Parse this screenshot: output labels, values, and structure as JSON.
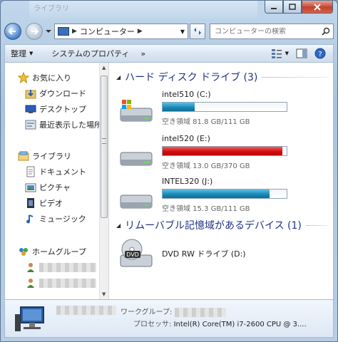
{
  "window": {
    "behind_text": "ライブラリ"
  },
  "address": {
    "breadcrumb": "コンピューター",
    "search_placeholder": "コンピューターの検索"
  },
  "toolbar": {
    "organize": "整理",
    "system_properties": "システムのプロパティ",
    "more": "»"
  },
  "nav": {
    "favorites": "お気に入り",
    "downloads": "ダウンロード",
    "desktop": "デスクトップ",
    "recent": "最近表示した場所",
    "libraries": "ライブラリ",
    "documents": "ドキュメント",
    "pictures": "ピクチャ",
    "videos": "ビデオ",
    "music": "ミュージック",
    "homegroup": "ホームグループ"
  },
  "groups": {
    "hdd": "ハード ディスク ドライブ (3)",
    "removable": "リムーバブル記憶域があるデバイス (1)"
  },
  "drives": [
    {
      "name": "intel510 (C:)",
      "free": "空き領域 81.8 GB/111 GB",
      "used_fraction": 0.26,
      "color": "#1b8ab6"
    },
    {
      "name": "intel520 (E:)",
      "free": "空き領域 13.0 GB/370 GB",
      "used_fraction": 0.965,
      "color": "#d40f0f"
    },
    {
      "name": "INTEL320 (J:)",
      "free": "空き領域 15.3 GB/111 GB",
      "used_fraction": 0.86,
      "color": "#1b8ab6"
    }
  ],
  "dvd": {
    "name": "DVD RW ドライブ (D:)"
  },
  "details": {
    "workgroup_label": "ワークグループ:",
    "processor_label": "プロセッサ:",
    "processor_value": "Intel(R) Core(TM) i7-2600 CPU @ 3...."
  }
}
